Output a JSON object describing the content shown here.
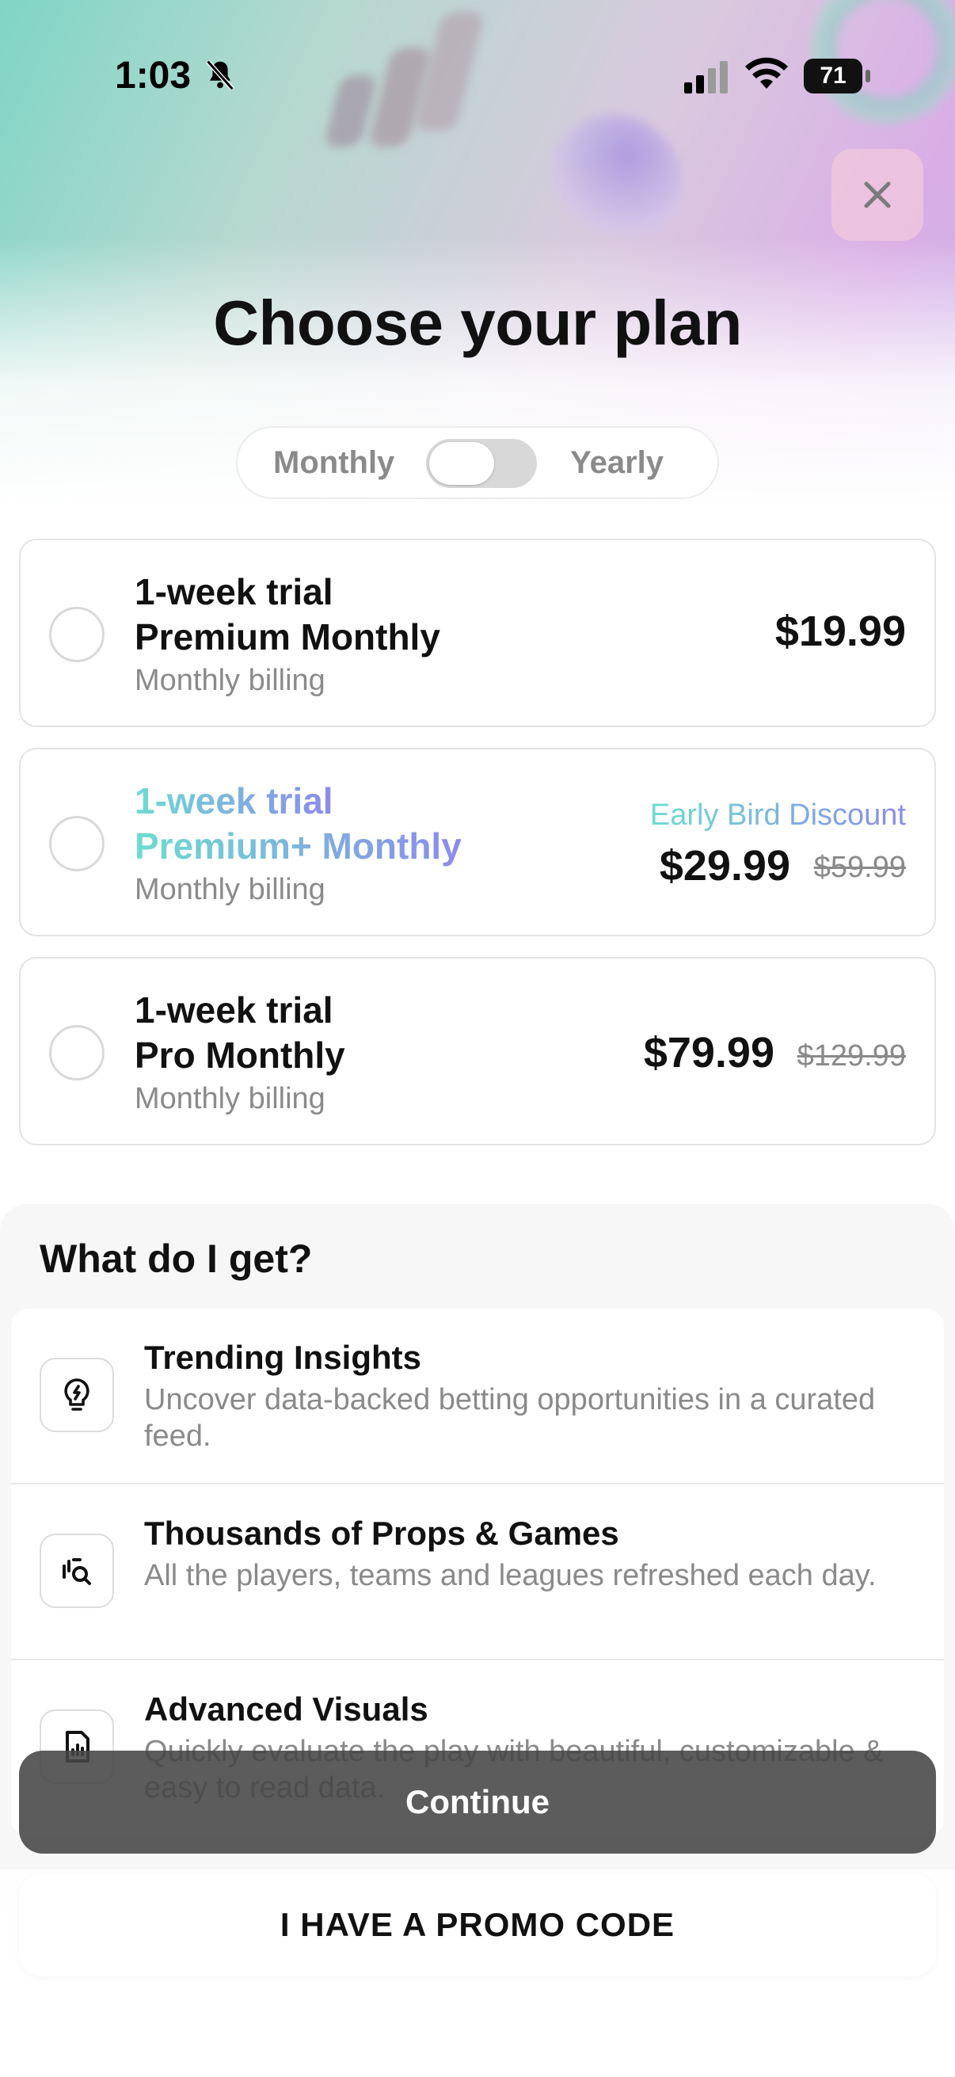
{
  "status_bar": {
    "time": "1:03",
    "battery": "71"
  },
  "header": {
    "title": "Choose your plan"
  },
  "billing_toggle": {
    "left_label": "Monthly",
    "right_label": "Yearly",
    "selected": "Monthly"
  },
  "plans": [
    {
      "trial": "1-week trial",
      "name": "Premium Monthly",
      "billing": "Monthly billing",
      "price": "$19.99"
    },
    {
      "trial": "1-week trial",
      "name": "Premium+ Monthly",
      "billing": "Monthly billing",
      "badge": "Early Bird Discount",
      "price": "$29.99",
      "old_price": "$59.99"
    },
    {
      "trial": "1-week trial",
      "name": "Pro Monthly",
      "billing": "Monthly billing",
      "price": "$79.99",
      "old_price": "$129.99"
    }
  ],
  "features": {
    "title": "What do I get?",
    "items": [
      {
        "icon": "lightbulb-icon",
        "title": "Trending Insights",
        "description": "Uncover data-backed betting opportunities in a curated feed."
      },
      {
        "icon": "search-props-icon",
        "title": "Thousands of Props & Games",
        "description": "All the players, teams and leagues refreshed each day."
      },
      {
        "icon": "chart-icon",
        "title": "Advanced Visuals",
        "description": "Quickly evaluate the play with beautiful, customizable & easy to read data."
      }
    ]
  },
  "actions": {
    "continue_label": "Continue",
    "promo_label": "I HAVE A PROMO CODE"
  },
  "colors": {
    "accent_gradient_start": "#6ddcd0",
    "accent_gradient_end": "#8d8aec",
    "continue_bg": "#464646"
  }
}
